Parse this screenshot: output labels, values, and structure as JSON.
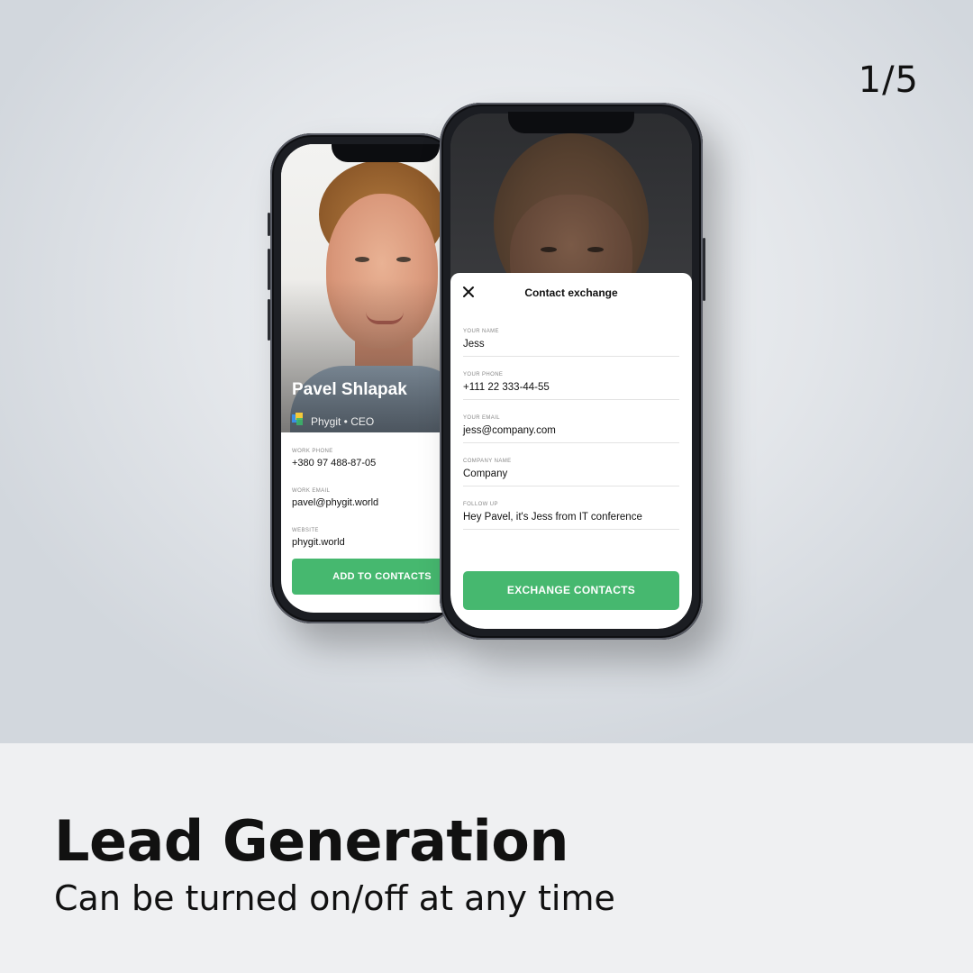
{
  "page_counter": "1/5",
  "headline": "Lead Generation",
  "subline": "Can be turned on/off at any time",
  "colors": {
    "accent_green": "#46b86f",
    "text_dark": "#111111"
  },
  "back_phone": {
    "name": "Pavel Shlapak",
    "company_line": "Phygit • CEO",
    "company_logo_icon": "phygit-logo-icon",
    "fields": [
      {
        "label": "WORK PHONE",
        "value": "+380 97 488-87-05"
      },
      {
        "label": "WORK EMAIL",
        "value": "pavel@phygit.world"
      },
      {
        "label": "WEBSITE",
        "value": "phygit.world"
      }
    ],
    "add_button": "ADD TO CONTACTS"
  },
  "front_phone": {
    "modal_title": "Contact exchange",
    "close_icon": "close-icon",
    "fields": [
      {
        "label": "YOUR NAME",
        "value": "Jess"
      },
      {
        "label": "YOUR PHONE",
        "value": "+111 22 333-44-55"
      },
      {
        "label": "YOUR EMAIL",
        "value": "jess@company.com"
      },
      {
        "label": "COMPANY NAME",
        "value": "Company"
      },
      {
        "label": "FOLLOW UP",
        "value": "Hey Pavel, it's Jess from IT conference"
      }
    ],
    "exchange_button": "EXCHANGE CONTACTS"
  }
}
